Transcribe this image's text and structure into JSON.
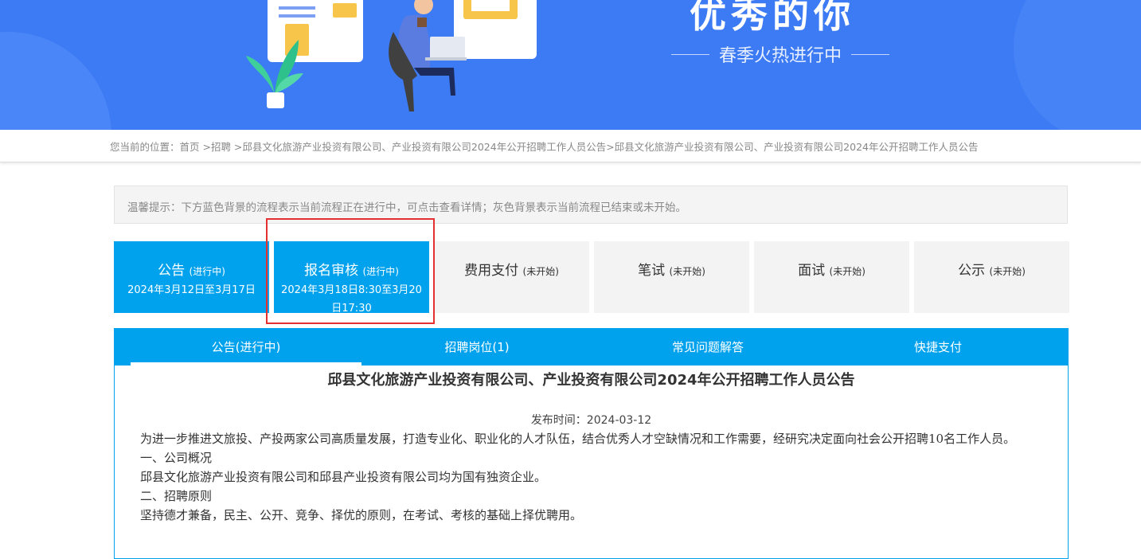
{
  "banner": {
    "title": "优秀的你",
    "subtitle": "春季火热进行中"
  },
  "breadcrumb": {
    "text": "您当前的位置：首页 >招聘 >邱县文化旅游产业投资有限公司、产业投资有限公司2024年公开招聘工作人员公告>邱县文化旅游产业投资有限公司、产业投资有限公司2024年公开招聘工作人员公告"
  },
  "tip": "温馨提示：下方蓝色背景的流程表示当前流程正在进行中，可点击查看详情；灰色背景表示当前流程已结束或未开始。",
  "steps": [
    {
      "name": "公告",
      "status": "(进行中)",
      "date": "2024年3月12日至3月17日"
    },
    {
      "name": "报名审核",
      "status": "(进行中)",
      "date": "2024年3月18日8:30至3月20日17:30"
    },
    {
      "name": "费用支付",
      "status": "(未开始)",
      "date": ""
    },
    {
      "name": "笔试",
      "status": "(未开始)",
      "date": ""
    },
    {
      "name": "面试",
      "status": "(未开始)",
      "date": ""
    },
    {
      "name": "公示",
      "status": "(未开始)",
      "date": ""
    }
  ],
  "tabs": [
    {
      "label": "公告(进行中)"
    },
    {
      "label": "招聘岗位(1)"
    },
    {
      "label": "常见问题解答"
    },
    {
      "label": "快捷支付"
    }
  ],
  "article": {
    "title": "邱县文化旅游产业投资有限公司、产业投资有限公司2024年公开招聘工作人员公告",
    "publish": "发布时间：2024-03-12",
    "paragraphs": [
      "为进一步推进文旅投、产投两家公司高质量发展，打造专业化、职业化的人才队伍，结合优秀人才空缺情况和工作需要，经研究决定面向社会公开招聘10名工作人员。",
      "一、公司概况",
      "邱县文化旅游产业投资有限公司和邱县产业投资有限公司均为国有独资企业。",
      "二、招聘原则",
      "坚持德才兼备，民主、公开、竞争、择优的原则，在考试、考核的基础上择优聘用。"
    ]
  },
  "colors": {
    "banner_blue": "#3d7bf4",
    "active_step": "#00a2ed",
    "idle_step": "#f3f3f3",
    "highlight_red": "#e53030"
  }
}
